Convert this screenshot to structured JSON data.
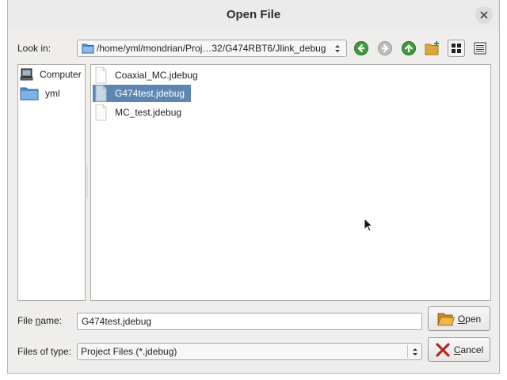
{
  "window": {
    "title": "Open File"
  },
  "look_in": {
    "label": "Look in:",
    "path": "/home/yml/mondrian/Proj…32/G474RBT6/Jlink_debug",
    "icons": [
      "folder-icon",
      "back-icon",
      "forward-icon",
      "up-icon",
      "new-folder-icon",
      "list-view-icon",
      "detail-view-icon"
    ]
  },
  "places": [
    {
      "label": "Computer",
      "icon": "computer-icon"
    },
    {
      "label": "yml",
      "icon": "folder-icon"
    }
  ],
  "files": [
    {
      "name": "Coaxial_MC.jdebug",
      "icon": "file-icon",
      "selected": false
    },
    {
      "name": "G474test.jdebug",
      "icon": "file-icon",
      "selected": true
    },
    {
      "name": "MC_test.jdebug",
      "icon": "file-icon",
      "selected": false
    }
  ],
  "filename": {
    "label_pre": "File ",
    "label_mnemonic": "n",
    "label_post": "ame:",
    "value": "G474test.jdebug"
  },
  "filetype": {
    "label": "Files of type:",
    "value": "Project Files (*.jdebug)"
  },
  "buttons": {
    "open_mnemonic": "O",
    "open_rest": "pen",
    "cancel_mnemonic": "C",
    "cancel_rest": "ancel"
  },
  "colors": {
    "selection": "#5d87b2",
    "nav_green": "#3e9a3c",
    "folder_blue": "#4f8fd6",
    "folder_orange": "#e0a537"
  }
}
